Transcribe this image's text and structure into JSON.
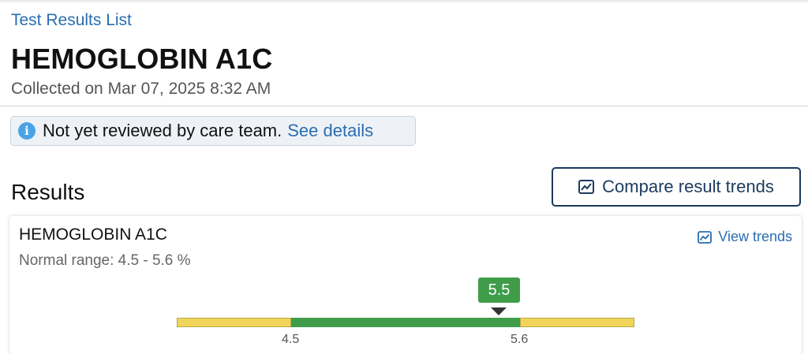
{
  "breadcrumb": "Test Results List",
  "page_title": "HEMOGLOBIN A1C",
  "collected": "Collected on Mar 07, 2025 8:32 AM",
  "notice": {
    "icon": "info-icon",
    "text": "Not yet reviewed by care team.",
    "link": "See details"
  },
  "results": {
    "heading": "Results",
    "compare_button": "Compare result trends",
    "compare_icon": "chart-trend-icon"
  },
  "card": {
    "title": "HEMOGLOBIN A1C",
    "view_trends": "View trends",
    "normal_range": "Normal range: 4.5 - 5.6 %",
    "value": "5.5",
    "range_low": "4.5",
    "range_high": "5.6"
  },
  "colors": {
    "link": "#2a6db0",
    "button_border": "#1c3a5e",
    "normal_green": "#3f9d4a",
    "out_of_range_yellow": "#f0d55a",
    "info_blue": "#4aa3e6"
  }
}
